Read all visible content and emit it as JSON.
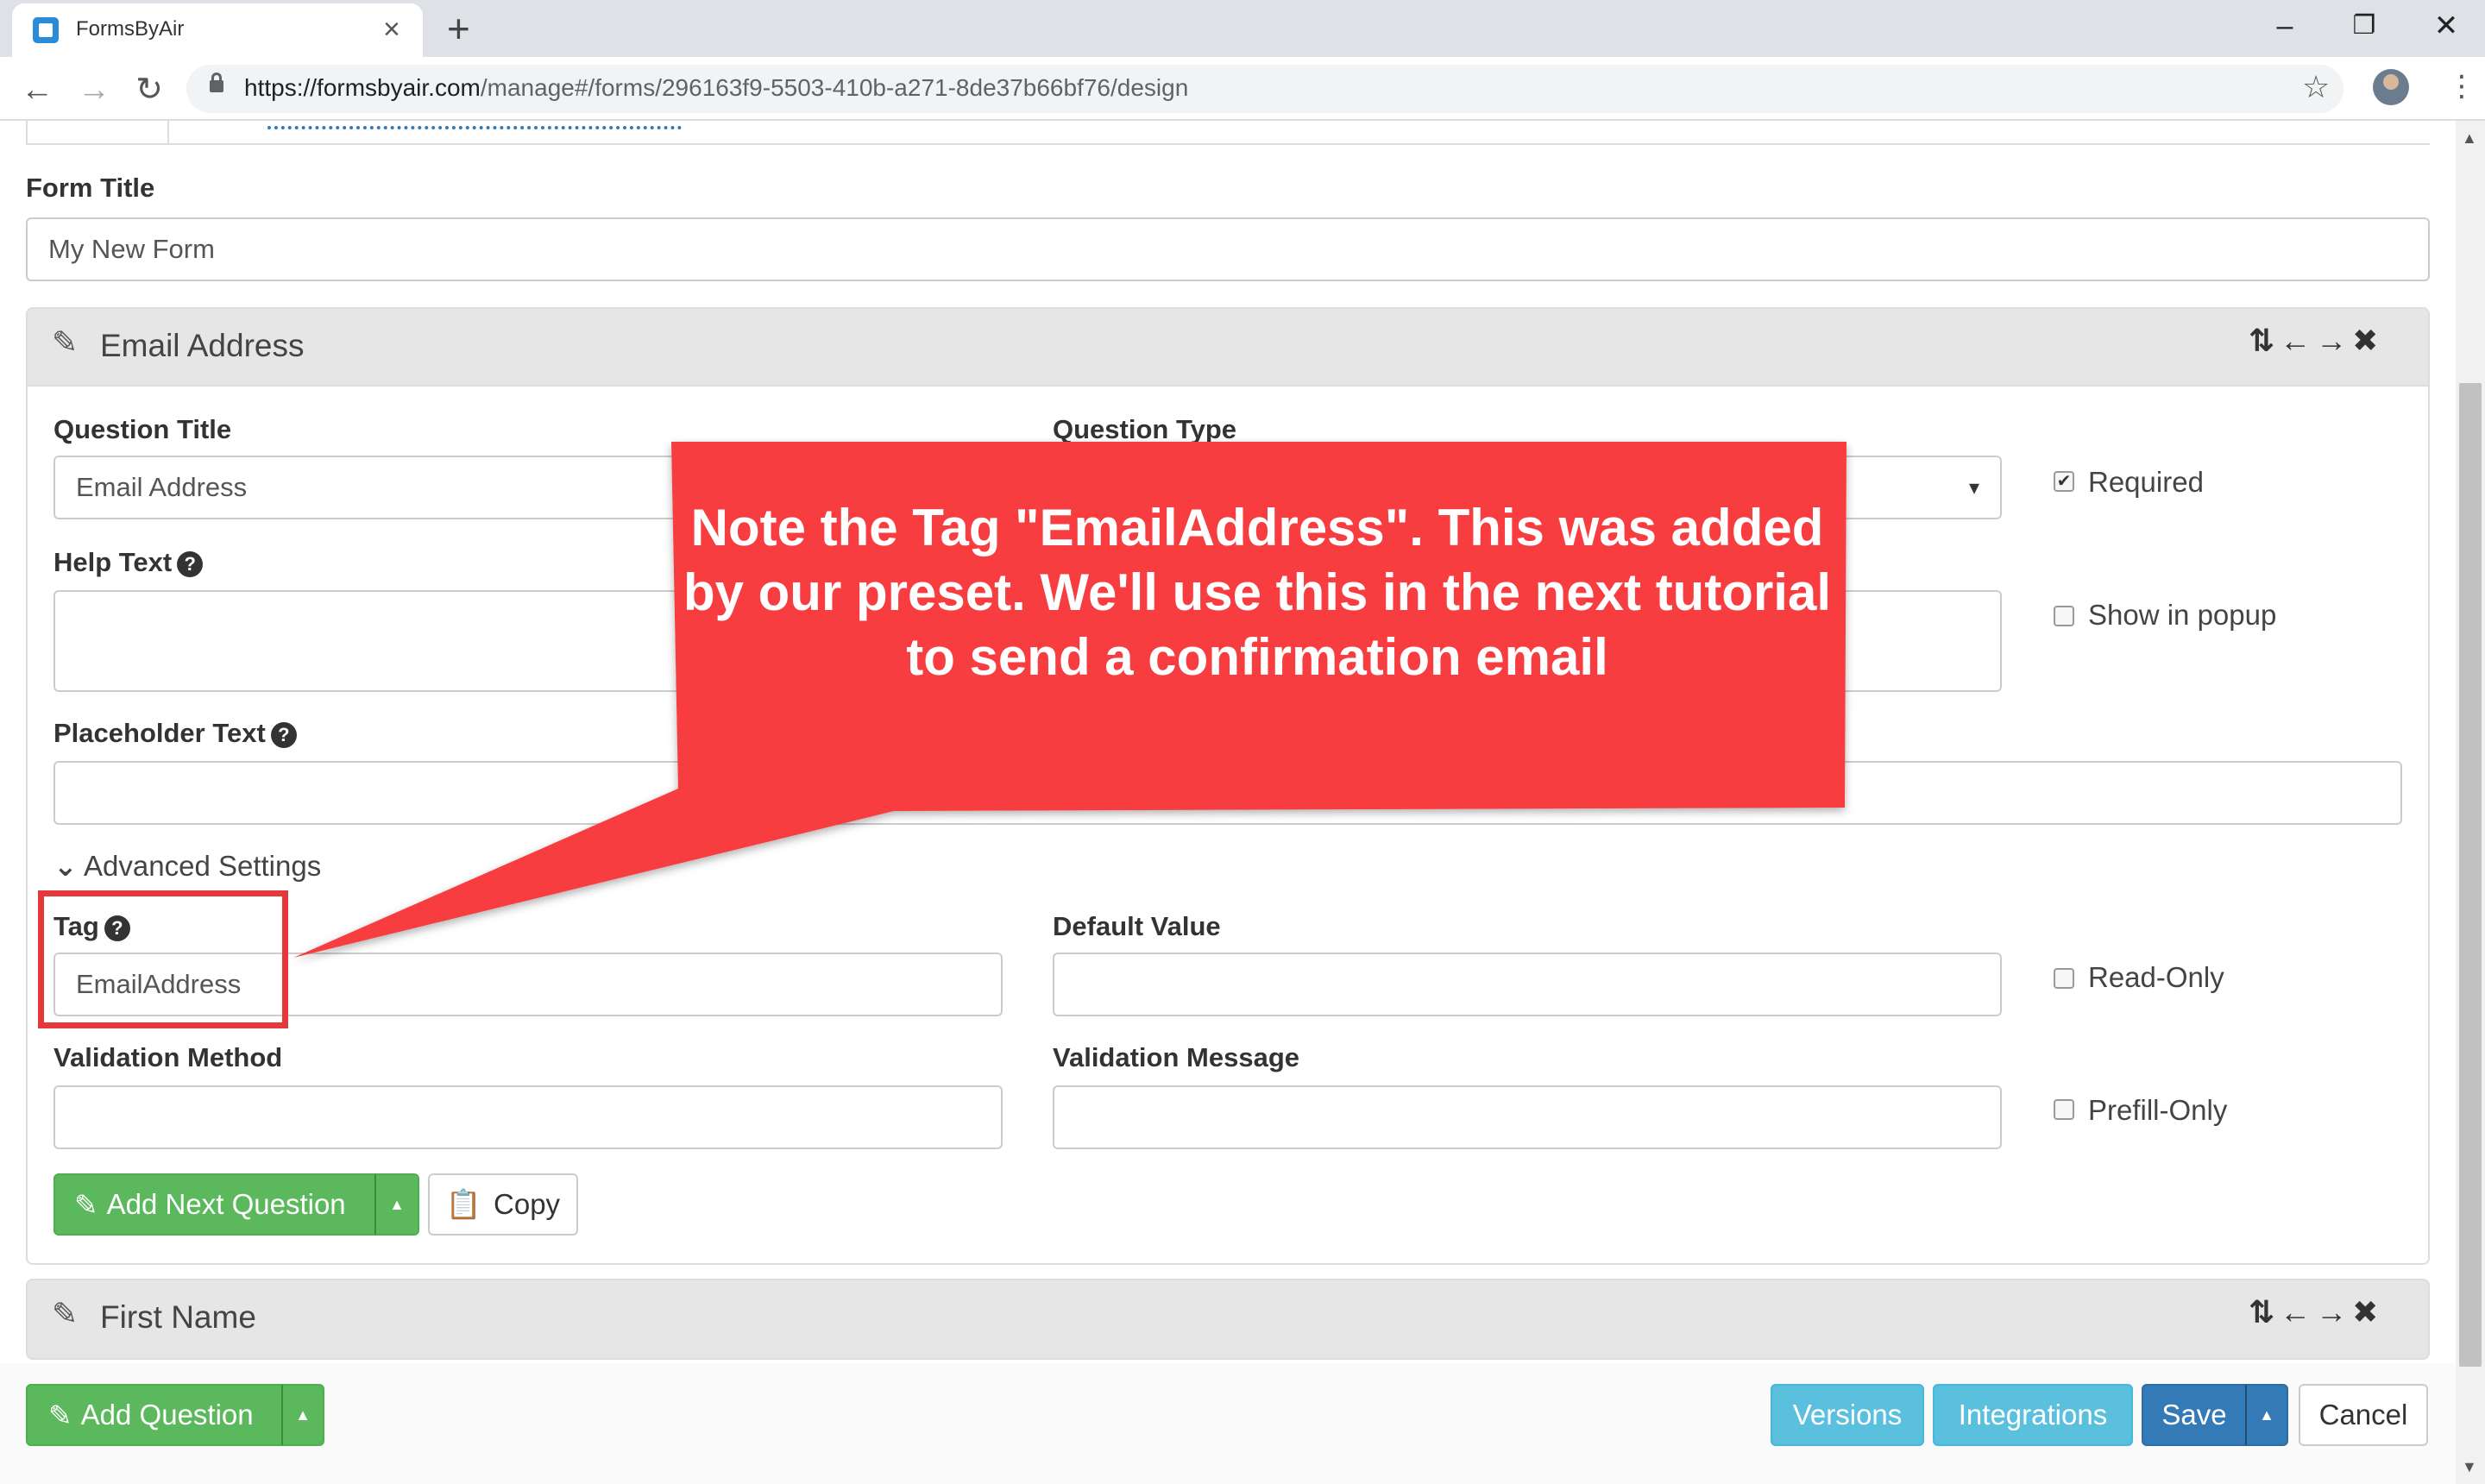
{
  "browser": {
    "tab_title": "FormsByAir",
    "tab_close": "×",
    "new_tab": "+",
    "window_controls": {
      "minimize": "–",
      "restore": "❐",
      "close": "✕"
    },
    "url_host": "https://formsbyair.com",
    "url_path": "/manage#/forms/296163f9-5503-410b-a271-8de37b66bf76/design",
    "back": "←",
    "forward": "→",
    "reload": "↻",
    "star": "☆",
    "menu": "⋮"
  },
  "form": {
    "title_label": "Form Title",
    "title_value": "My New Form"
  },
  "question": {
    "header_title": "Email Address",
    "question_title_label": "Question Title",
    "question_title_value": "Email Address",
    "question_type_label": "Question Type",
    "select_arrow": "▾",
    "required_label": "Required",
    "required_checked": "✔",
    "help_text_label": "Help Text",
    "show_in_popup_label": "Show in popup",
    "placeholder_text_label": "Placeholder Text",
    "advanced_settings_label": "Advanced Settings",
    "tag_label": "Tag",
    "tag_value": "EmailAddress",
    "default_value_label": "Default Value",
    "read_only_label": "Read-Only",
    "validation_method_label": "Validation Method",
    "validation_message_label": "Validation Message",
    "prefill_only_label": "Prefill-Only",
    "add_next_question_label": "Add Next Question",
    "copy_label": "Copy",
    "help_glyph": "?"
  },
  "next_question": {
    "header_title": "First Name"
  },
  "panel_controls": "⇅ ← → ✖",
  "footer": {
    "add_question_label": "Add Question",
    "versions_label": "Versions",
    "integrations_label": "Integrations",
    "save_label": "Save",
    "cancel_label": "Cancel"
  },
  "callout": {
    "text": "Note the Tag \"EmailAddress\". This was added by our preset. We'll use this in the next tutorial to send a confirmation email"
  },
  "colors": {
    "callout": "#f73c3f",
    "success": "#5cb85c",
    "info": "#5bc0de",
    "primary": "#337ab7"
  }
}
